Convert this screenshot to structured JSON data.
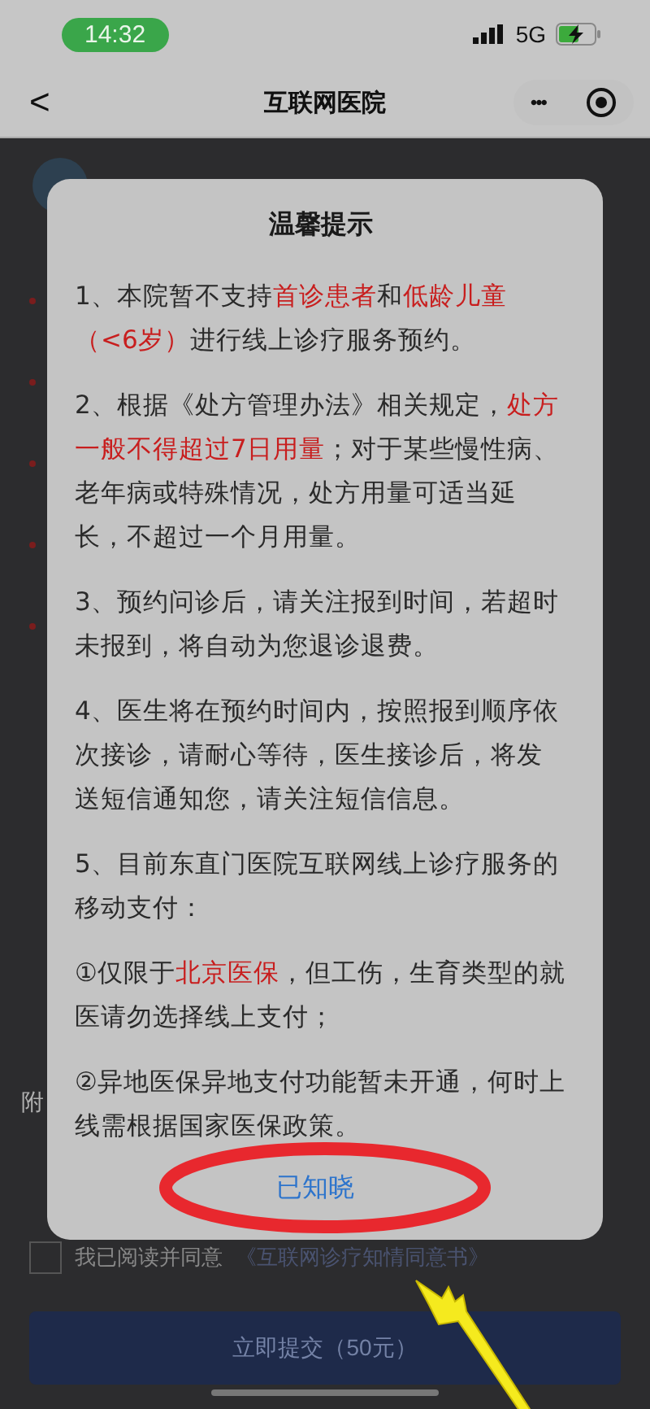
{
  "status_bar": {
    "time": "14:32",
    "network": "5G"
  },
  "nav": {
    "back": "<",
    "title": "互联网医院",
    "more": "•••"
  },
  "background": {
    "field_label": "附",
    "agreement": {
      "checked": false,
      "text": "我已阅读并同意",
      "link": "《互联网诊疗知情同意书》"
    },
    "submit": "立即提交（50元）"
  },
  "dialog": {
    "title": "温馨提示",
    "paragraphs": [
      [
        {
          "text": "1、本院暂不支持",
          "highlight": false
        },
        {
          "text": "首诊患者",
          "highlight": true
        },
        {
          "text": "和",
          "highlight": false
        },
        {
          "text": "低龄儿童（<6岁）",
          "highlight": true
        },
        {
          "text": "进行线上诊疗服务预约。",
          "highlight": false
        }
      ],
      [
        {
          "text": "2、根据《处方管理办法》相关规定，",
          "highlight": false
        },
        {
          "text": "处方一般不得超过7日用量",
          "highlight": true
        },
        {
          "text": "；对于某些慢性病、老年病或特殊情况，处方用量可适当延长，不超过一个月用量。",
          "highlight": false
        }
      ],
      [
        {
          "text": "3、预约问诊后，请关注报到时间，若超时未报到，将自动为您退诊退费。",
          "highlight": false
        }
      ],
      [
        {
          "text": "4、医生将在预约时间内，按照报到顺序依次接诊，请耐心等待，医生接诊后，将发送短信通知您，请关注短信信息。",
          "highlight": false
        }
      ],
      [
        {
          "text": "5、目前东直门医院互联网线上诊疗服务的移动支付：",
          "highlight": false
        }
      ],
      [
        {
          "text": "①仅限于",
          "highlight": false
        },
        {
          "text": "北京医保",
          "highlight": true
        },
        {
          "text": "，但工伤，生育类型的就医请勿选择线上支付；",
          "highlight": false
        }
      ],
      [
        {
          "text": "②异地医保异地支付功能暂未开通，何时上线需根据国家医保政策。",
          "highlight": false
        }
      ]
    ],
    "button": "已知晓"
  }
}
